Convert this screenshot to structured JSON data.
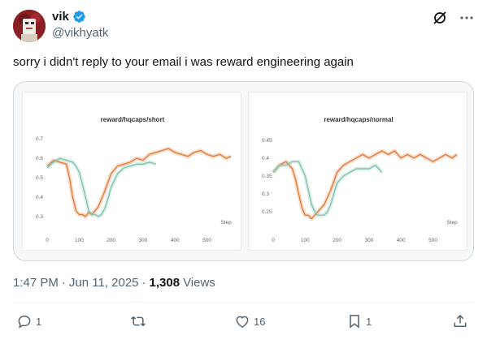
{
  "author": {
    "display_name": "vik",
    "handle": "@vikhyatk",
    "verified": true
  },
  "tweet": {
    "text": "sorry i didn't reply to your email i was reward engineering again"
  },
  "meta": {
    "time": "1:47 PM",
    "separator1": "·",
    "date": "Jun 11, 2025",
    "separator2": "·",
    "views_count": "1,308",
    "views_label": "Views"
  },
  "actions": {
    "replies": "1",
    "reposts": "",
    "likes": "16",
    "bookmarks": "1"
  },
  "colors": {
    "orange": "#e07b39",
    "teal": "#7fc4b0",
    "verified_blue": "#1d9bf0"
  },
  "icons": [
    "grok-icon",
    "more-icon",
    "reply-icon",
    "repost-icon",
    "like-icon",
    "bookmark-icon",
    "share-icon",
    "verified-badge-icon"
  ],
  "chart_data": [
    {
      "type": "line",
      "title": "reward/hqcaps/short",
      "x_tick_labels": [
        "0",
        "100",
        "200",
        "300",
        "400",
        "500"
      ],
      "y_tick_labels": [
        "0.7",
        "0.6",
        "0.5",
        "0.4",
        "0.3"
      ],
      "xlabel": "Step",
      "xlim": [
        0,
        580
      ],
      "ylim": [
        0.27,
        0.73
      ],
      "grid": false,
      "series": [
        {
          "color": "#e07b39",
          "x": [
            0,
            20,
            40,
            60,
            70,
            80,
            90,
            100,
            110,
            120,
            130,
            140,
            160,
            180,
            200,
            220,
            240,
            260,
            280,
            300,
            320,
            340,
            360,
            380,
            400,
            420,
            440,
            460,
            480,
            500,
            520,
            540,
            560,
            575
          ],
          "y": [
            0.56,
            0.59,
            0.58,
            0.57,
            0.5,
            0.4,
            0.33,
            0.31,
            0.31,
            0.3,
            0.32,
            0.31,
            0.35,
            0.43,
            0.52,
            0.56,
            0.57,
            0.58,
            0.6,
            0.59,
            0.62,
            0.63,
            0.64,
            0.65,
            0.63,
            0.62,
            0.61,
            0.63,
            0.64,
            0.62,
            0.61,
            0.62,
            0.6,
            0.61
          ]
        },
        {
          "color": "#7fc4b0",
          "x": [
            0,
            20,
            40,
            60,
            80,
            90,
            100,
            110,
            120,
            130,
            140,
            150,
            160,
            170,
            180,
            190,
            200,
            220,
            240,
            260,
            280,
            300,
            320,
            340
          ],
          "y": [
            0.55,
            0.58,
            0.6,
            0.59,
            0.58,
            0.56,
            0.53,
            0.47,
            0.4,
            0.33,
            0.31,
            0.31,
            0.3,
            0.31,
            0.34,
            0.39,
            0.45,
            0.52,
            0.55,
            0.56,
            0.57,
            0.57,
            0.58,
            0.57
          ]
        }
      ]
    },
    {
      "type": "line",
      "title": "reward/hqcaps/normal",
      "x_tick_labels": [
        "0",
        "100",
        "200",
        "300",
        "400",
        "500"
      ],
      "y_tick_labels": [
        "0.45",
        "0.4",
        "0.35",
        "0.3",
        "0.25"
      ],
      "xlabel": "Step",
      "xlim": [
        0,
        580
      ],
      "ylim": [
        0.22,
        0.47
      ],
      "grid": false,
      "series": [
        {
          "color": "#e07b39",
          "x": [
            0,
            20,
            40,
            60,
            70,
            80,
            90,
            100,
            110,
            120,
            130,
            140,
            160,
            180,
            200,
            220,
            240,
            260,
            280,
            300,
            320,
            340,
            360,
            380,
            400,
            420,
            440,
            460,
            480,
            500,
            520,
            540,
            560,
            575
          ],
          "y": [
            0.36,
            0.38,
            0.39,
            0.37,
            0.34,
            0.3,
            0.26,
            0.24,
            0.24,
            0.23,
            0.24,
            0.25,
            0.27,
            0.31,
            0.36,
            0.38,
            0.39,
            0.4,
            0.41,
            0.4,
            0.41,
            0.42,
            0.41,
            0.42,
            0.4,
            0.41,
            0.4,
            0.41,
            0.4,
            0.39,
            0.4,
            0.41,
            0.4,
            0.41
          ]
        },
        {
          "color": "#7fc4b0",
          "x": [
            0,
            20,
            40,
            60,
            80,
            90,
            100,
            110,
            120,
            130,
            140,
            150,
            160,
            170,
            180,
            190,
            200,
            220,
            240,
            260,
            280,
            300,
            320,
            340
          ],
          "y": [
            0.36,
            0.38,
            0.38,
            0.39,
            0.39,
            0.37,
            0.35,
            0.31,
            0.27,
            0.25,
            0.24,
            0.24,
            0.24,
            0.25,
            0.27,
            0.3,
            0.33,
            0.35,
            0.36,
            0.37,
            0.37,
            0.37,
            0.38,
            0.36
          ]
        }
      ]
    }
  ]
}
